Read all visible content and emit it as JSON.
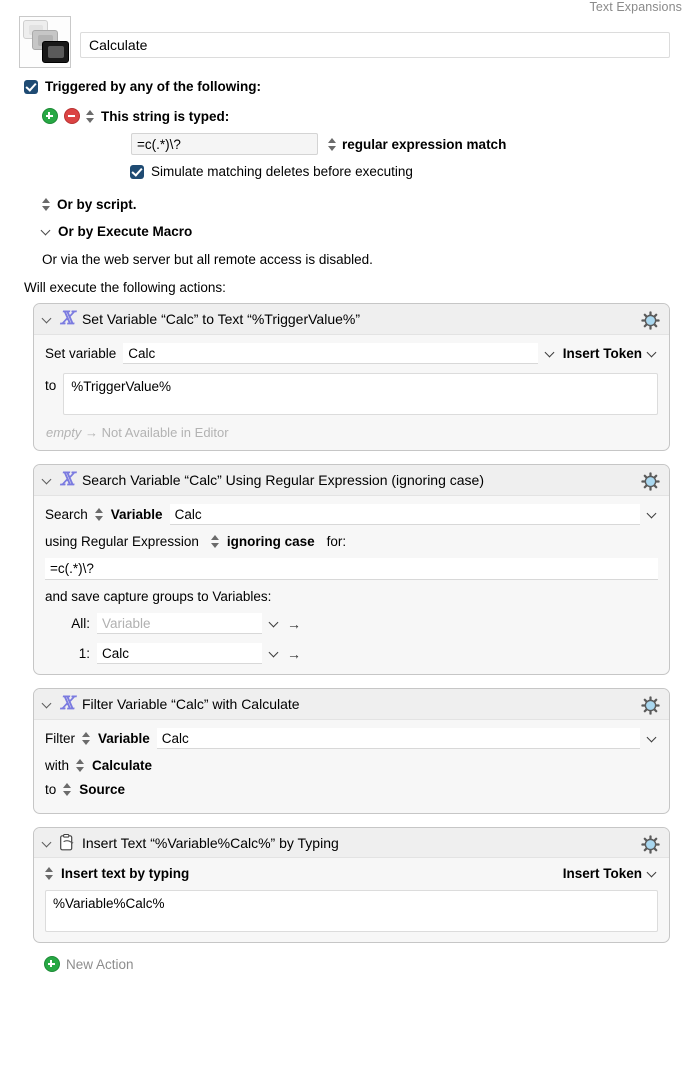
{
  "group_label": "Text Expansions",
  "macro": {
    "icon": "stacked-keycaps-icon",
    "name": "Calculate"
  },
  "triggers": {
    "enabled_label": "Triggered by any of the following:",
    "add_icon": "plus-circle-icon",
    "remove_icon": "minus-circle-icon",
    "type_label": "This string is typed:",
    "string_value": "=c(.*)\\?",
    "match_mode": "regular expression match",
    "simulate_label": "Simulate matching deletes before executing",
    "or_by_script": "Or by script.",
    "or_by_execute_macro": "Or by Execute Macro",
    "web_server_note": "Or via the web server but all remote access is disabled."
  },
  "will_execute_label": "Will execute the following actions:",
  "actions": [
    {
      "icon": "script-x-icon",
      "title": "Set Variable “Calc” to Text “%TriggerValue%”",
      "gear_icon": "gear-icon",
      "set_variable_label": "Set variable",
      "variable_name": "Calc",
      "insert_token_label": "Insert Token",
      "to_label": "to",
      "to_value": "%TriggerValue%",
      "footer_empty": "empty",
      "footer_arrow": "→",
      "footer_status": "Not Available in Editor"
    },
    {
      "icon": "script-x-icon",
      "title": "Search Variable “Calc” Using Regular Expression (ignoring case)",
      "gear_icon": "gear-icon",
      "search_label": "Search",
      "source_type": "Variable",
      "variable_name": "Calc",
      "using_label": "using Regular Expression",
      "case_option": "ignoring case",
      "for_label": "for:",
      "regex_value": "=c(.*)\\?",
      "capture_label": "and save capture groups to Variables:",
      "captures": [
        {
          "index": "All:",
          "value": "",
          "placeholder": "Variable"
        },
        {
          "index": "1:",
          "value": "Calc",
          "placeholder": "Variable"
        }
      ]
    },
    {
      "icon": "script-x-icon",
      "title": "Filter Variable “Calc” with Calculate",
      "gear_icon": "gear-icon",
      "filter_label": "Filter",
      "source_type": "Variable",
      "variable_name": "Calc",
      "with_label": "with",
      "filter_type": "Calculate",
      "to_label": "to",
      "destination": "Source"
    },
    {
      "icon": "clipboard-insert-icon",
      "title": "Insert Text “%Variable%Calc%” by Typing",
      "gear_icon": "gear-icon",
      "mode_label": "Insert text by typing",
      "insert_token_label": "Insert Token",
      "text_value": "%Variable%Calc%"
    }
  ],
  "new_action_label": "New Action",
  "colors": {
    "checkbox": "#1f4b73",
    "add": "#27a844",
    "remove": "#db4343",
    "gear_center": "#a9d7ef",
    "script_icon": "#7b7be0",
    "panel_bg": "#f7f7f7",
    "panel_header_bg": "#efefef"
  }
}
